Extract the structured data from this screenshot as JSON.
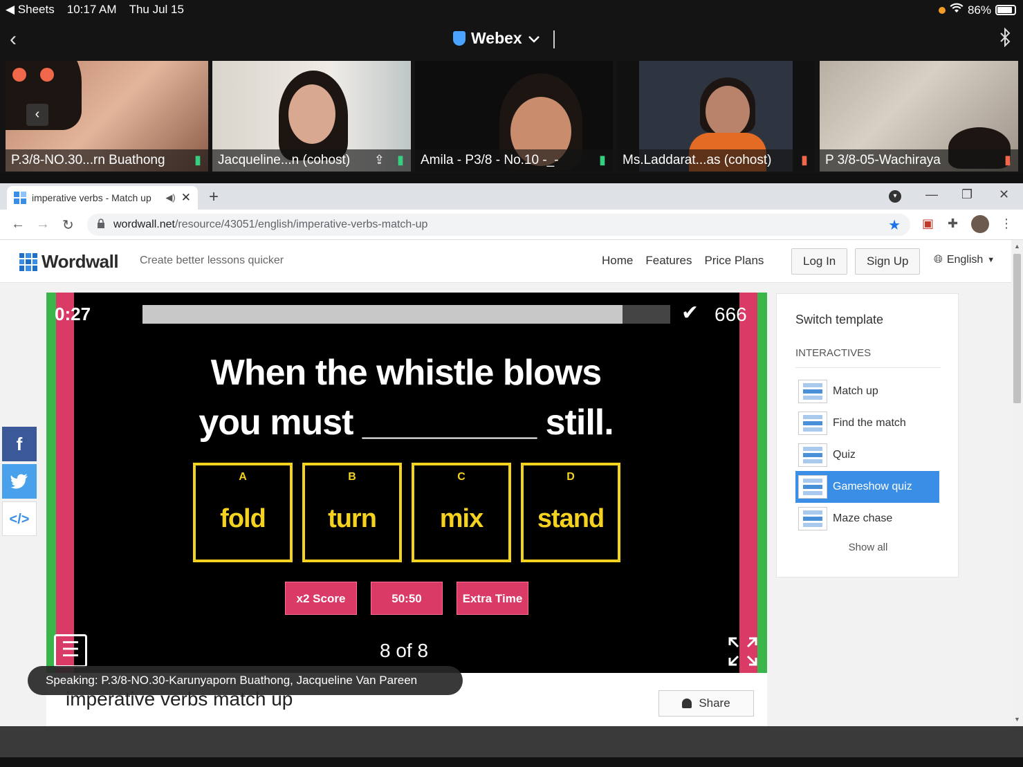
{
  "status_bar": {
    "back_app": "◀ Sheets",
    "time": "10:17 AM",
    "date": "Thu Jul 15",
    "battery": "86%"
  },
  "webex": {
    "title": "Webex"
  },
  "participants": [
    {
      "name": "P.3/8-NO.30...rn Buathong",
      "mic": "on"
    },
    {
      "name": "Jacqueline...n (cohost)",
      "mic": "on"
    },
    {
      "name": "Amila - P3/8 - No.10 -_-",
      "mic": "on"
    },
    {
      "name": "Ms.Laddarat...as (cohost)",
      "mic": "off"
    },
    {
      "name": "P 3/8-05-Wachiraya",
      "mic": "off"
    }
  ],
  "browser": {
    "tab_title": "imperative verbs - Match up",
    "url_host": "wordwall.net",
    "url_path": "/resource/43051/english/imperative-verbs-match-up"
  },
  "site": {
    "logo": "Wordwall",
    "tagline": "Create better lessons quicker",
    "nav": [
      "Home",
      "Features",
      "Price Plans"
    ],
    "login": "Log In",
    "signup": "Sign Up",
    "language": "English"
  },
  "game": {
    "timer": "0:27",
    "progress_fraction": 0.91,
    "score": "666",
    "question_line1": "When the whistle blows",
    "question_line2": "you must _________ still.",
    "answers": [
      {
        "letter": "A",
        "word": "fold"
      },
      {
        "letter": "B",
        "word": "turn"
      },
      {
        "letter": "C",
        "word": "mix"
      },
      {
        "letter": "D",
        "word": "stand"
      }
    ],
    "powerups": [
      "x2 Score",
      "50:50",
      "Extra Time"
    ],
    "counter": "8 of 8"
  },
  "activity": {
    "title": "imperative verbs match up",
    "share": "Share"
  },
  "switch_template": {
    "title": "Switch template",
    "section": "INTERACTIVES",
    "items": [
      {
        "label": "Match up",
        "active": false
      },
      {
        "label": "Find the match",
        "active": false
      },
      {
        "label": "Quiz",
        "active": false
      },
      {
        "label": "Gameshow quiz",
        "active": true
      },
      {
        "label": "Maze chase",
        "active": false
      }
    ],
    "show_all": "Show all"
  },
  "speaking": "Speaking: P.3/8-NO.30-Karunyaporn Buathong, Jacqueline Van Pareen",
  "colors": {
    "accent": "#3a8ee6",
    "game_yellow": "#f5d21f",
    "game_pink": "#d93a66",
    "game_green": "#39b54a"
  }
}
